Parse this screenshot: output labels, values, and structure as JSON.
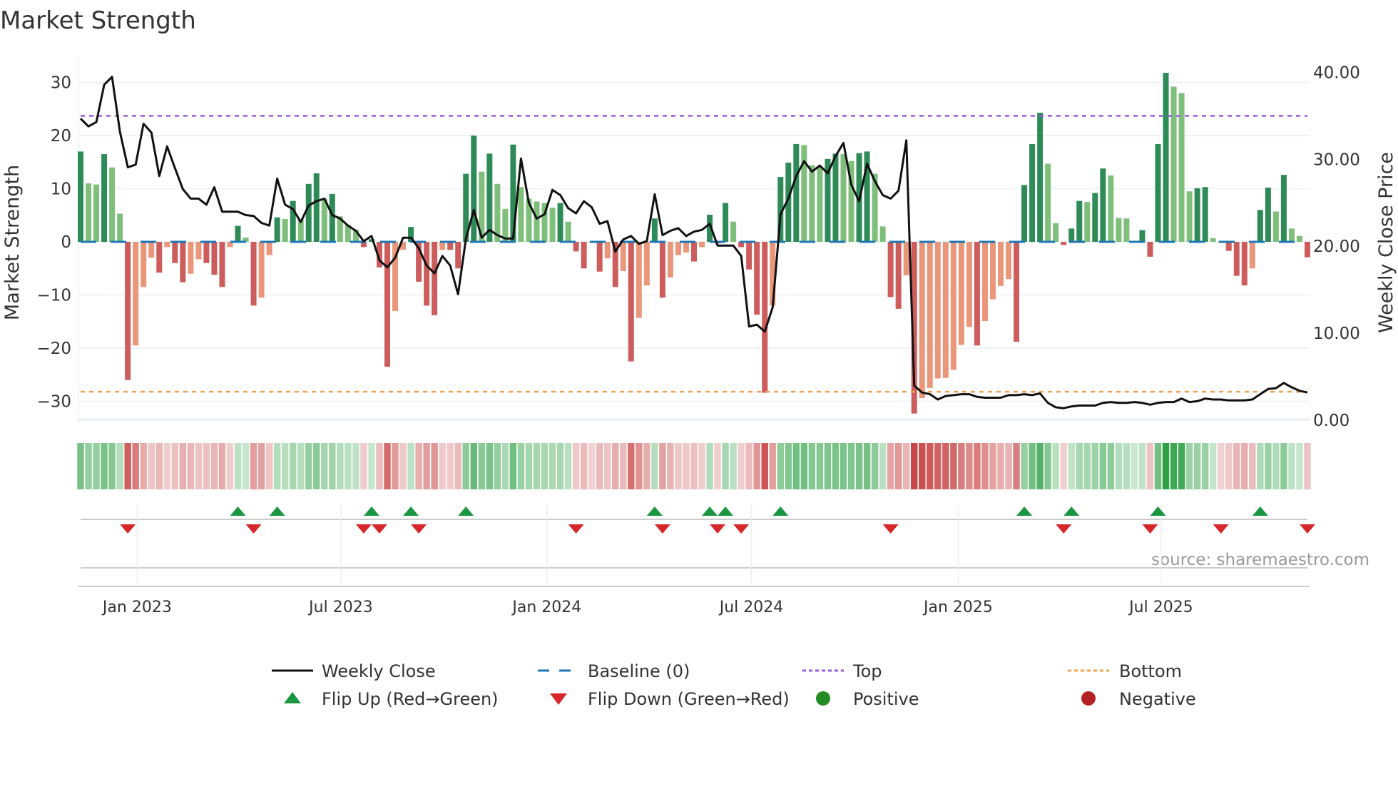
{
  "chart_data": {
    "type": "bar",
    "title": "Market Strength",
    "ylabel": "Market Strength",
    "y2label": "Weekly Close Price",
    "ylim": [
      -33,
      34
    ],
    "y2lim": [
      0,
      40
    ],
    "yticks": [
      30,
      20,
      10,
      0,
      -10,
      -20,
      -30
    ],
    "yticklabels": [
      "30",
      "20",
      "10",
      "0",
      "−10",
      "−20",
      "−30"
    ],
    "y2ticks": [
      40,
      30,
      20,
      10,
      0
    ],
    "y2ticklabels": [
      "40.00",
      "30.00",
      "20.00",
      "10.00",
      "0.00"
    ],
    "xticks": [
      {
        "week": 7.2,
        "label": "Jan 2023"
      },
      {
        "week": 33.1,
        "label": "Jul 2023"
      },
      {
        "week": 59.3,
        "label": "Jan 2024"
      },
      {
        "week": 85.3,
        "label": "Jul 2024"
      },
      {
        "week": 111.6,
        "label": "Jan 2025"
      },
      {
        "week": 137.4,
        "label": "Jul 2025"
      }
    ],
    "top_level": 23.7,
    "bottom_level": -28.2,
    "baseline": 0,
    "strength": [
      17,
      11,
      10.8,
      16.5,
      14,
      5.3,
      -26,
      -19.5,
      -8.5,
      -3,
      -5.8,
      -1,
      -4,
      -7.6,
      -6,
      -3.3,
      -4,
      -6.2,
      -8.5,
      -1,
      3,
      0.8,
      -12,
      -10.5,
      -2.5,
      4.6,
      4.3,
      7.7,
      4.2,
      10.9,
      12.9,
      8.1,
      9,
      4.8,
      3.2,
      2.3,
      -1,
      0.5,
      -4.8,
      -23.5,
      -13,
      -1.5,
      2.8,
      -7.5,
      -12,
      -13.8,
      -1.5,
      -1.5,
      -5,
      12.8,
      20,
      13.2,
      16.6,
      10.9,
      6.2,
      18.3,
      10.3,
      8.1,
      7.6,
      7.3,
      6.4,
      7.3,
      3.8,
      -1.8,
      -5,
      -0.2,
      -5.6,
      -3.1,
      -8.5,
      -5.5,
      -22.5,
      -14.3,
      -8.2,
      4.4,
      -10.5,
      -6.7,
      -2.5,
      -2,
      -3.7,
      -1,
      5.1,
      -0.3,
      7.3,
      3.8,
      -1,
      -5.2,
      -13.7,
      -28.4,
      -12,
      12.2,
      14.9,
      18.4,
      18.2,
      14.4,
      14,
      15.6,
      16.6,
      16.5,
      15.2,
      16.7,
      17,
      12.8,
      2.9,
      -10.4,
      -12.6,
      -6.3,
      -32.3,
      -29.4,
      -27.5,
      -25.7,
      -25.6,
      -24.1,
      -19.4,
      -16,
      -19.5,
      -14.9,
      -10.8,
      -8.3,
      -7,
      -18.8,
      10.7,
      18.4,
      24.3,
      14.7,
      3.5,
      -0.6,
      2.5,
      7.7,
      7.5,
      9.2,
      13.8,
      12.5,
      4.5,
      4.4,
      0.1,
      2.2,
      -2.8,
      18.4,
      31.8,
      29.2,
      28,
      9.5,
      10.1,
      10.3,
      0.7,
      -0.1,
      -1.7,
      -6.4,
      -8.2,
      -5,
      6,
      10.2,
      5.7,
      12.6,
      2.5,
      1.1,
      -2.9
    ],
    "weekly_close": [
      34.6,
      33.7,
      34.2,
      38.5,
      39.4,
      33.1,
      29,
      29.3,
      34,
      33,
      28,
      31.4,
      28.9,
      26.5,
      25.4,
      25.4,
      24.7,
      26.7,
      23.9,
      23.9,
      23.9,
      23.5,
      23.4,
      22.6,
      22.3,
      27.7,
      24.7,
      24.2,
      22.7,
      24.6,
      25.1,
      25.4,
      23.5,
      23.1,
      22.3,
      21.7,
      20.5,
      21.1,
      18.3,
      17.5,
      18.6,
      20.9,
      20.9,
      19.7,
      17.7,
      16.8,
      18.8,
      17.7,
      14.4,
      20.8,
      24.1,
      20.9,
      21.8,
      21.2,
      20.8,
      20.8,
      30,
      24.9,
      23.1,
      23.6,
      26.4,
      25.8,
      24.3,
      23.7,
      25.1,
      24.4,
      22.5,
      22.8,
      19.3,
      20.7,
      21.1,
      20.2,
      20.5,
      25.9,
      21.2,
      21.7,
      22,
      21.1,
      21.6,
      21.8,
      22.5,
      20,
      20,
      20,
      18.8,
      10.7,
      10.9,
      10.1,
      12.9,
      23.6,
      25.4,
      28,
      29.7,
      28.5,
      29.2,
      28.3,
      30.3,
      31.8,
      27,
      25.1,
      29.4,
      27.4,
      25.8,
      25.4,
      26.3,
      32.1,
      3.9,
      3.1,
      2.9,
      2.3,
      2.7,
      2.8,
      2.9,
      2.9,
      2.6,
      2.5,
      2.5,
      2.5,
      2.8,
      2.8,
      2.9,
      2.8,
      3,
      1.9,
      1.4,
      1.3,
      1.5,
      1.6,
      1.6,
      1.6,
      1.9,
      2,
      1.9,
      1.9,
      2,
      1.9,
      1.7,
      1.9,
      2,
      2,
      2.4,
      2,
      2.1,
      2.4,
      2.3,
      2.3,
      2.2,
      2.2,
      2.2,
      2.3,
      2.9,
      3.5,
      3.6,
      4.2,
      3.7,
      3.3,
      3.1
    ],
    "flip_up_weeks": [
      20,
      25,
      37,
      42,
      49,
      73,
      80,
      82,
      89,
      120,
      126,
      137,
      150
    ],
    "flip_down_weeks": [
      6,
      22,
      36,
      38,
      43,
      63,
      74,
      81,
      84,
      103,
      125,
      136,
      145,
      156
    ],
    "legend": [
      {
        "label": "Weekly Close",
        "kind": "line"
      },
      {
        "label": "Baseline (0)",
        "kind": "dash"
      },
      {
        "label": "Top",
        "kind": "dot-purple"
      },
      {
        "label": "Bottom",
        "kind": "dot-orange"
      },
      {
        "label": "Flip Up (Red→Green)",
        "kind": "tri-up"
      },
      {
        "label": "Flip Down (Green→Red)",
        "kind": "tri-down"
      },
      {
        "label": "Positive",
        "kind": "dot-green"
      },
      {
        "label": "Negative",
        "kind": "dot-red"
      }
    ],
    "legend_position": "bottom",
    "source": "source: sharemaestro.com"
  },
  "colors": {
    "pos_up": "#2e8b57",
    "pos_down": "#7fbf7b",
    "neg_down": "#cd5c5c",
    "neg_up": "#e9967a",
    "line": "#111111",
    "baseline": "#1f77b4",
    "top": "#9b59d6",
    "bottom": "#f0a050",
    "flip_up": "#1a9641",
    "flip_down": "#d7262a",
    "positive": "#228b22",
    "negative": "#b22222"
  }
}
